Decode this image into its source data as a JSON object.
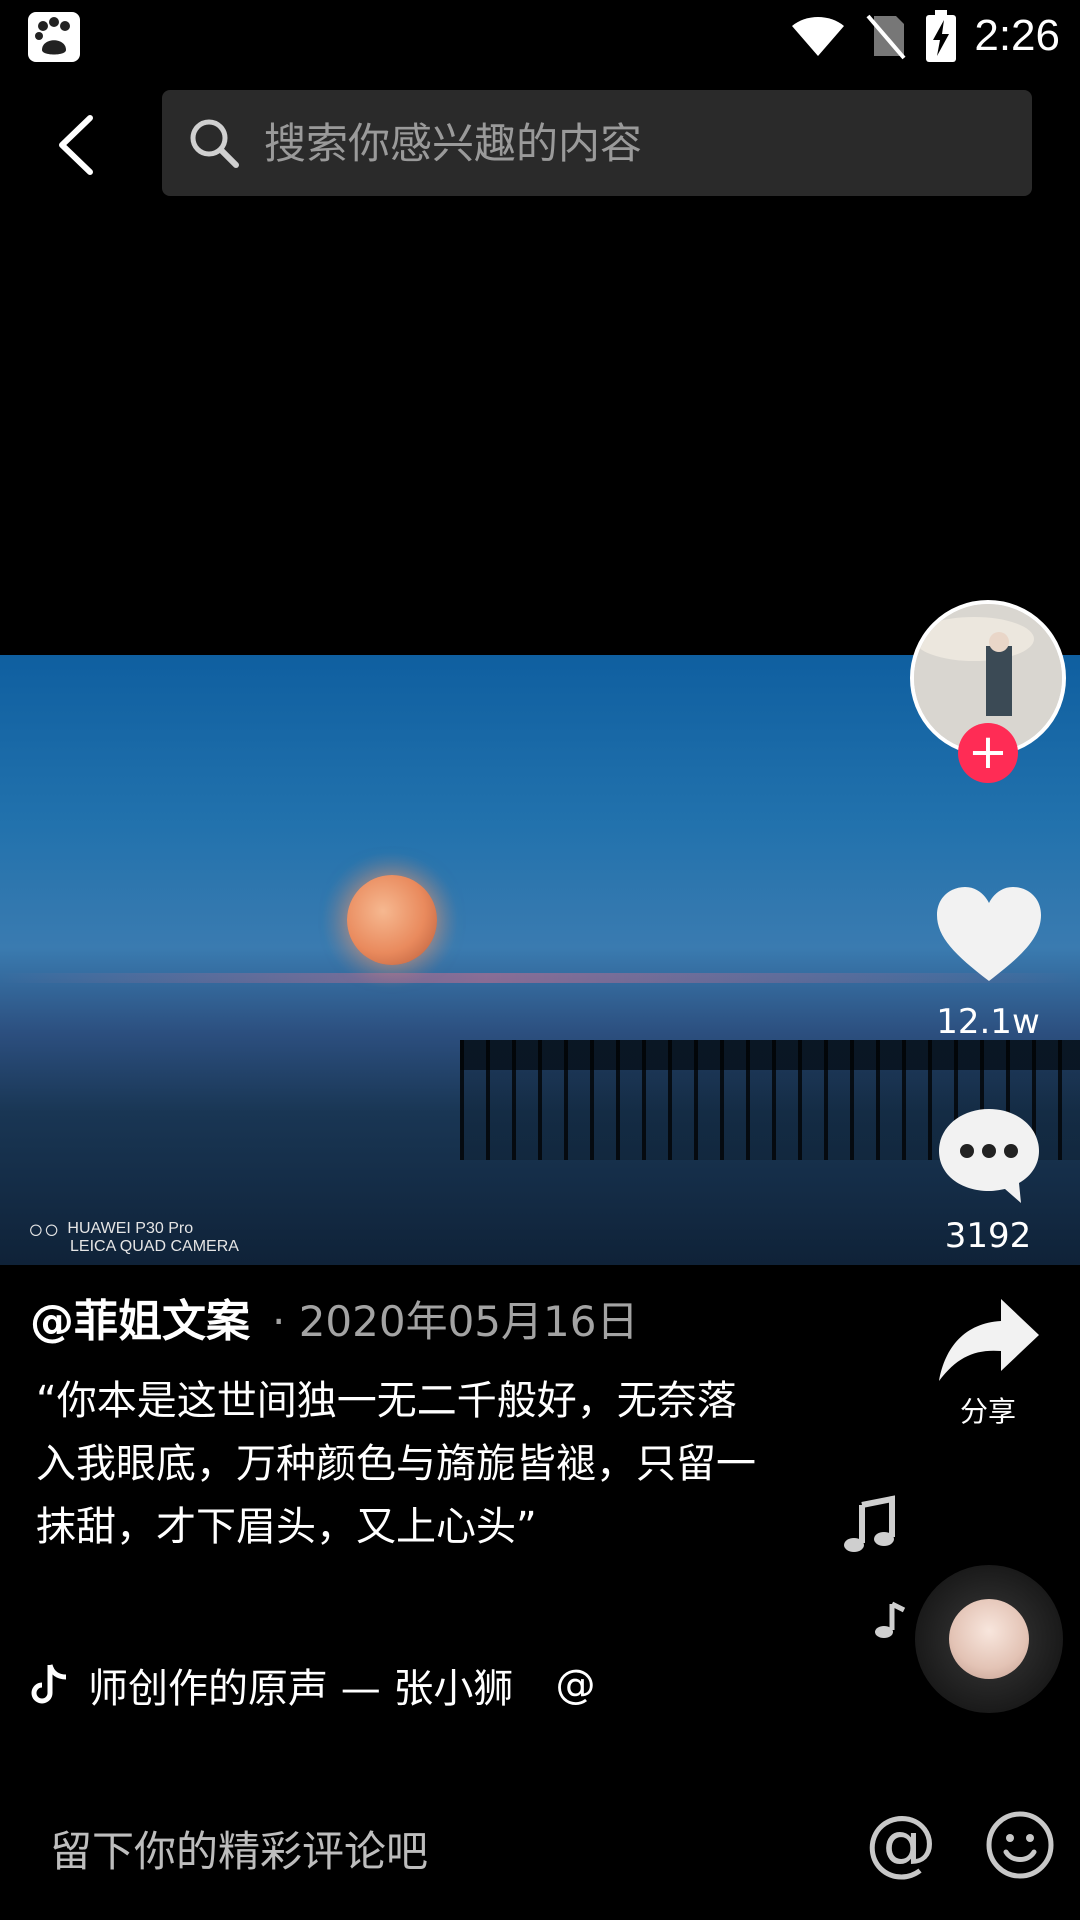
{
  "status_bar": {
    "time": "2:26"
  },
  "search": {
    "placeholder": "搜索你感兴趣的内容"
  },
  "video": {
    "watermark_line1": "HUAWEI P30 Pro",
    "watermark_line2": "LEICA QUAD CAMERA"
  },
  "actions": {
    "like_count": "12.1w",
    "comment_count": "3192",
    "share_label": "分享"
  },
  "post": {
    "username": "@菲姐文案",
    "date": "· 2020年05月16日",
    "caption": "“你本是这世间独一无二千般好，无奈落入我眼底，万种颜色与旖旎皆褪，只留一抹甜，才下眉头，又上心头”",
    "music_text": "师创作的原声 — 张小狮",
    "music_at": "@"
  },
  "comment_bar": {
    "placeholder": "留下你的精彩评论吧",
    "at_label": "@"
  },
  "colors": {
    "accent": "#ff2c55",
    "search_bg": "#2a2a2a"
  }
}
